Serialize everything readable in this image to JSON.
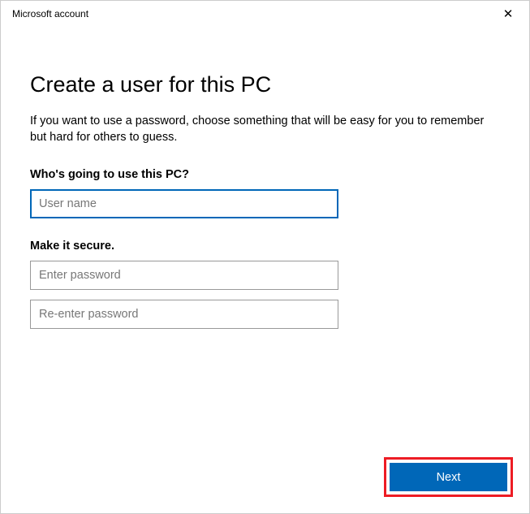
{
  "titlebar": {
    "title": "Microsoft account"
  },
  "page": {
    "heading": "Create a user for this PC",
    "subtext": "If you want to use a password, choose something that will be easy for you to remember but hard for others to guess."
  },
  "username": {
    "label": "Who's going to use this PC?",
    "placeholder": "User name",
    "value": ""
  },
  "password": {
    "label": "Make it secure.",
    "placeholder": "Enter password",
    "confirm_placeholder": "Re-enter password"
  },
  "buttons": {
    "next": "Next"
  },
  "colors": {
    "accent": "#0067b8",
    "highlight_border": "#ed1c24"
  }
}
